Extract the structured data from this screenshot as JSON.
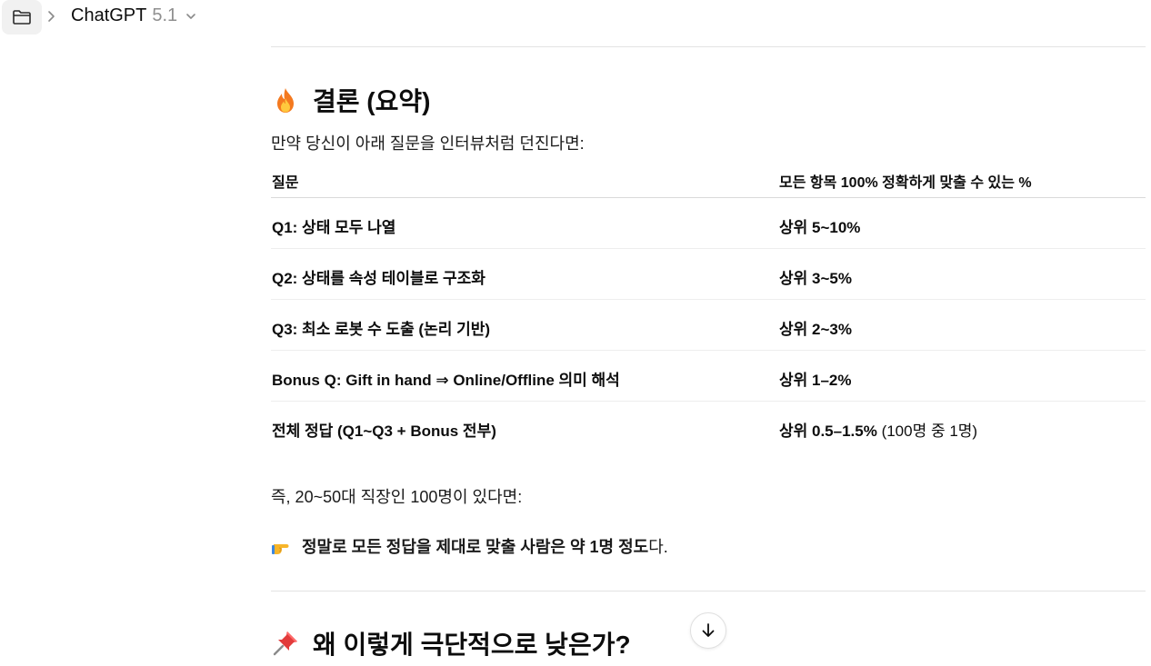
{
  "header": {
    "folder_icon": "folder-icon",
    "title": "ChatGPT",
    "version": "5.1"
  },
  "section1": {
    "emoji": "fire-icon",
    "heading": "결론 (요약)",
    "intro": "만약 당신이 아래 질문을 인터뷰처럼 던진다면:"
  },
  "table": {
    "headers": [
      "질문",
      "모든 항목 100% 정확하게 맞출 수 있는 %"
    ],
    "rows": [
      {
        "q": "Q1: 상태 모두 나열",
        "p": "상위 5~10%",
        "note": ""
      },
      {
        "q": "Q2: 상태를 속성 테이블로 구조화",
        "p": "상위 3~5%",
        "note": ""
      },
      {
        "q": "Q3: 최소 로봇 수 도출 (논리 기반)",
        "p": "상위 2~3%",
        "note": ""
      },
      {
        "q": "Bonus Q: Gift in hand ⇒ Online/Offline 의미 해석",
        "p": "상위 1–2%",
        "note": ""
      },
      {
        "q": "전체 정답 (Q1~Q3 + Bonus 전부)",
        "p": "상위 0.5–1.5%",
        "note": " (100명 중 1명)"
      }
    ]
  },
  "summary": {
    "line1": "즉, 20~50대 직장인 100명이 있다면:",
    "pointer_emoji": "pointing-hand-icon",
    "line2_bold": "정말로 모든 정답을 제대로 맞출 사람은 약 1명 정도",
    "line2_rest": "다."
  },
  "section2": {
    "emoji": "pushpin-icon",
    "heading": "왜 이렇게 극단적으로 낮은가?"
  },
  "scroll_button": {
    "icon": "arrow-down-icon"
  }
}
